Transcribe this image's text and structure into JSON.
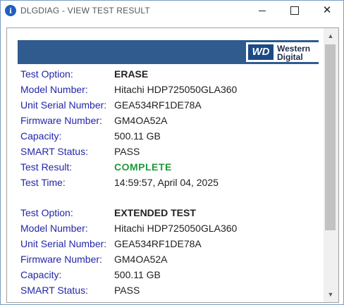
{
  "window": {
    "title": "DLGDIAG - VIEW TEST RESULT",
    "icon": "info-icon",
    "controls": {
      "minimize": "minimize-icon",
      "maximize": "maximize-icon",
      "close": "✕"
    }
  },
  "brand": {
    "mark": "WD",
    "line1": "Western",
    "line2": "Digital",
    "color": "#2f5b8f"
  },
  "results": [
    {
      "test_option_label": "Test Option:",
      "test_option": "ERASE",
      "model_label": "Model Number:",
      "model": "Hitachi HDP725050GLA360",
      "serial_label": "Unit Serial Number:",
      "serial": "GEA534RF1DE78A",
      "firmware_label": "Firmware Number:",
      "firmware": "GM4OA52A",
      "capacity_label": "Capacity:",
      "capacity": "500.11 GB",
      "smart_label": "SMART Status:",
      "smart": "PASS",
      "result_label": "Test Result:",
      "result": "COMPLETE",
      "time_label": "Test Time:",
      "time": "14:59:57, April 04, 2025"
    },
    {
      "test_option_label": "Test Option:",
      "test_option": "EXTENDED TEST",
      "model_label": "Model Number:",
      "model": "Hitachi HDP725050GLA360",
      "serial_label": "Unit Serial Number:",
      "serial": "GEA534RF1DE78A",
      "firmware_label": "Firmware Number:",
      "firmware": "GM4OA52A",
      "capacity_label": "Capacity:",
      "capacity": "500.11 GB",
      "smart_label": "SMART Status:",
      "smart": "PASS"
    }
  ],
  "scrollbar": {
    "up": "▲",
    "down": "▼"
  }
}
